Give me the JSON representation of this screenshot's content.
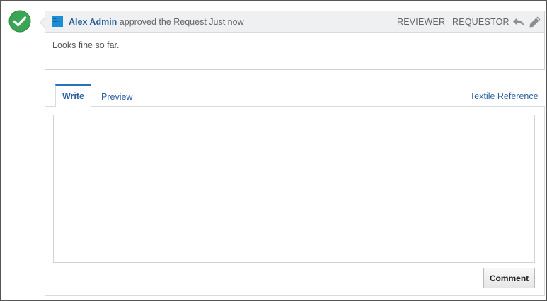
{
  "status": {
    "icon": "check-circle-icon",
    "color": "#3aa655"
  },
  "comment": {
    "avatar_text": "Alex Admin",
    "author": "Alex Admin",
    "action": " approved the Request ",
    "time": "Just now",
    "roles": [
      "REVIEWER",
      "REQUESTOR"
    ],
    "body": "Looks fine so far.",
    "reply_icon": "reply-icon",
    "edit_icon": "pencil-icon"
  },
  "editor": {
    "tabs": [
      "Write",
      "Preview"
    ],
    "active_tab": "Write",
    "help_link": "Textile Reference",
    "textarea_value": "",
    "submit_label": "Comment"
  },
  "colors": {
    "accent": "#2a72b8",
    "link": "#2a5f9e",
    "header_bg": "#eef0f2",
    "avatar_bg": "#1a8fd6"
  }
}
